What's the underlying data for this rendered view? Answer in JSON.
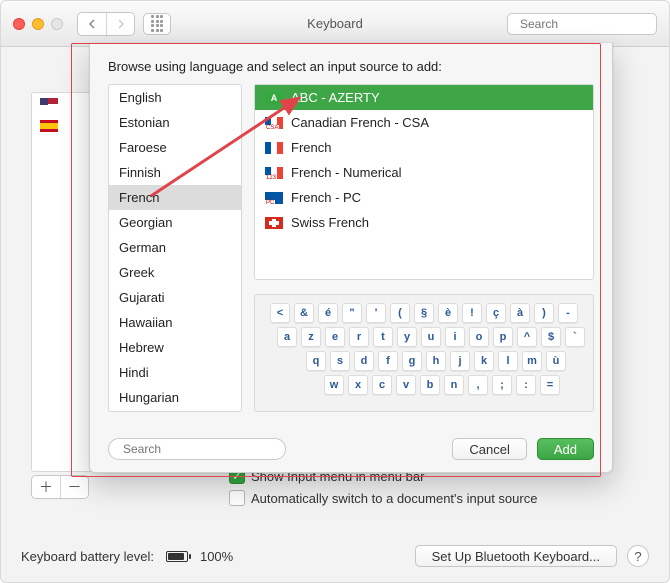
{
  "toolbar": {
    "title": "Keyboard",
    "search_placeholder": "Search"
  },
  "backdrop": {
    "flag_rows": [
      {
        "flag": "us"
      },
      {
        "flag": "es"
      }
    ],
    "checks": {
      "show_input_menu": "Show Input menu in menu bar",
      "auto_switch": "Automatically switch to a document's input source"
    }
  },
  "sheet": {
    "header": "Browse using language and select an input source to add:",
    "languages": [
      "English",
      "Estonian",
      "Faroese",
      "Finnish",
      "French",
      "Georgian",
      "German",
      "Greek",
      "Gujarati",
      "Hawaiian",
      "Hebrew",
      "Hindi",
      "Hungarian"
    ],
    "selected_language_index": 4,
    "sources": [
      {
        "label": "ABC - AZERTY",
        "flag": "abc",
        "selected": true
      },
      {
        "label": "Canadian French - CSA",
        "flag": "csa"
      },
      {
        "label": "French",
        "flag": "fr"
      },
      {
        "label": "French - Numerical",
        "flag": "123"
      },
      {
        "label": "French - PC",
        "flag": "pc"
      },
      {
        "label": "Swiss French",
        "flag": "ch"
      }
    ],
    "keyboard_rows": [
      [
        "<",
        "&",
        "é",
        "\"",
        "'",
        "(",
        "§",
        "è",
        "!",
        "ç",
        "à",
        ")",
        "-"
      ],
      [
        "a",
        "z",
        "e",
        "r",
        "t",
        "y",
        "u",
        "i",
        "o",
        "p",
        "^",
        "$",
        "`"
      ],
      [
        "q",
        "s",
        "d",
        "f",
        "g",
        "h",
        "j",
        "k",
        "l",
        "m",
        "ù"
      ],
      [
        "w",
        "x",
        "c",
        "v",
        "b",
        "n",
        ",",
        ";",
        ":",
        "="
      ]
    ],
    "search_placeholder": "Search",
    "cancel_label": "Cancel",
    "add_label": "Add"
  },
  "bottom": {
    "battery_label": "Keyboard battery level:",
    "battery_value": "100%",
    "bluetooth_label": "Set Up Bluetooth Keyboard..."
  }
}
